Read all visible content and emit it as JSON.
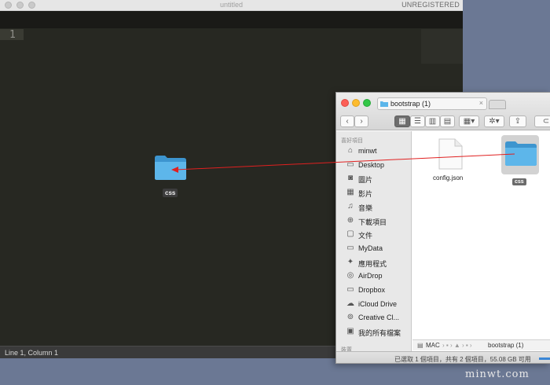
{
  "editor": {
    "title": "untitled",
    "unregistered": "UNREGISTERED",
    "line_number": "1",
    "status": "Line 1, Column 1",
    "dragged_label": "css"
  },
  "finder": {
    "tab_title": "bootstrap (1)",
    "tab_close": "×",
    "sidebar_heading": "喜好項目",
    "sidebar_heading2": "裝置",
    "sidebar": [
      {
        "label": "minwt",
        "icon": "home-icon"
      },
      {
        "label": "Desktop",
        "icon": "folder-icon"
      },
      {
        "label": "圖片",
        "icon": "camera-icon"
      },
      {
        "label": "影片",
        "icon": "film-icon"
      },
      {
        "label": "音樂",
        "icon": "music-icon"
      },
      {
        "label": "下載項目",
        "icon": "download-icon"
      },
      {
        "label": "文件",
        "icon": "document-icon"
      },
      {
        "label": "MyData",
        "icon": "folder-icon"
      },
      {
        "label": "應用程式",
        "icon": "apps-icon"
      },
      {
        "label": "AirDrop",
        "icon": "airdrop-icon"
      },
      {
        "label": "Dropbox",
        "icon": "folder-icon"
      },
      {
        "label": "iCloud Drive",
        "icon": "cloud-icon"
      },
      {
        "label": "Creative Cl...",
        "icon": "creative-cloud-icon"
      },
      {
        "label": "我的所有檔案",
        "icon": "all-files-icon"
      }
    ],
    "files": [
      {
        "name": "config.json"
      },
      {
        "name": "css"
      }
    ],
    "path": {
      "mac": "MAC",
      "end": "bootstrap (1)"
    },
    "status": "已選取 1 個項目，共有 2 個項目，55.08 GB 可用"
  },
  "watermark": "minwt.com",
  "colors": {
    "folder": "#4aa8e0",
    "arrow": "#e02020"
  }
}
